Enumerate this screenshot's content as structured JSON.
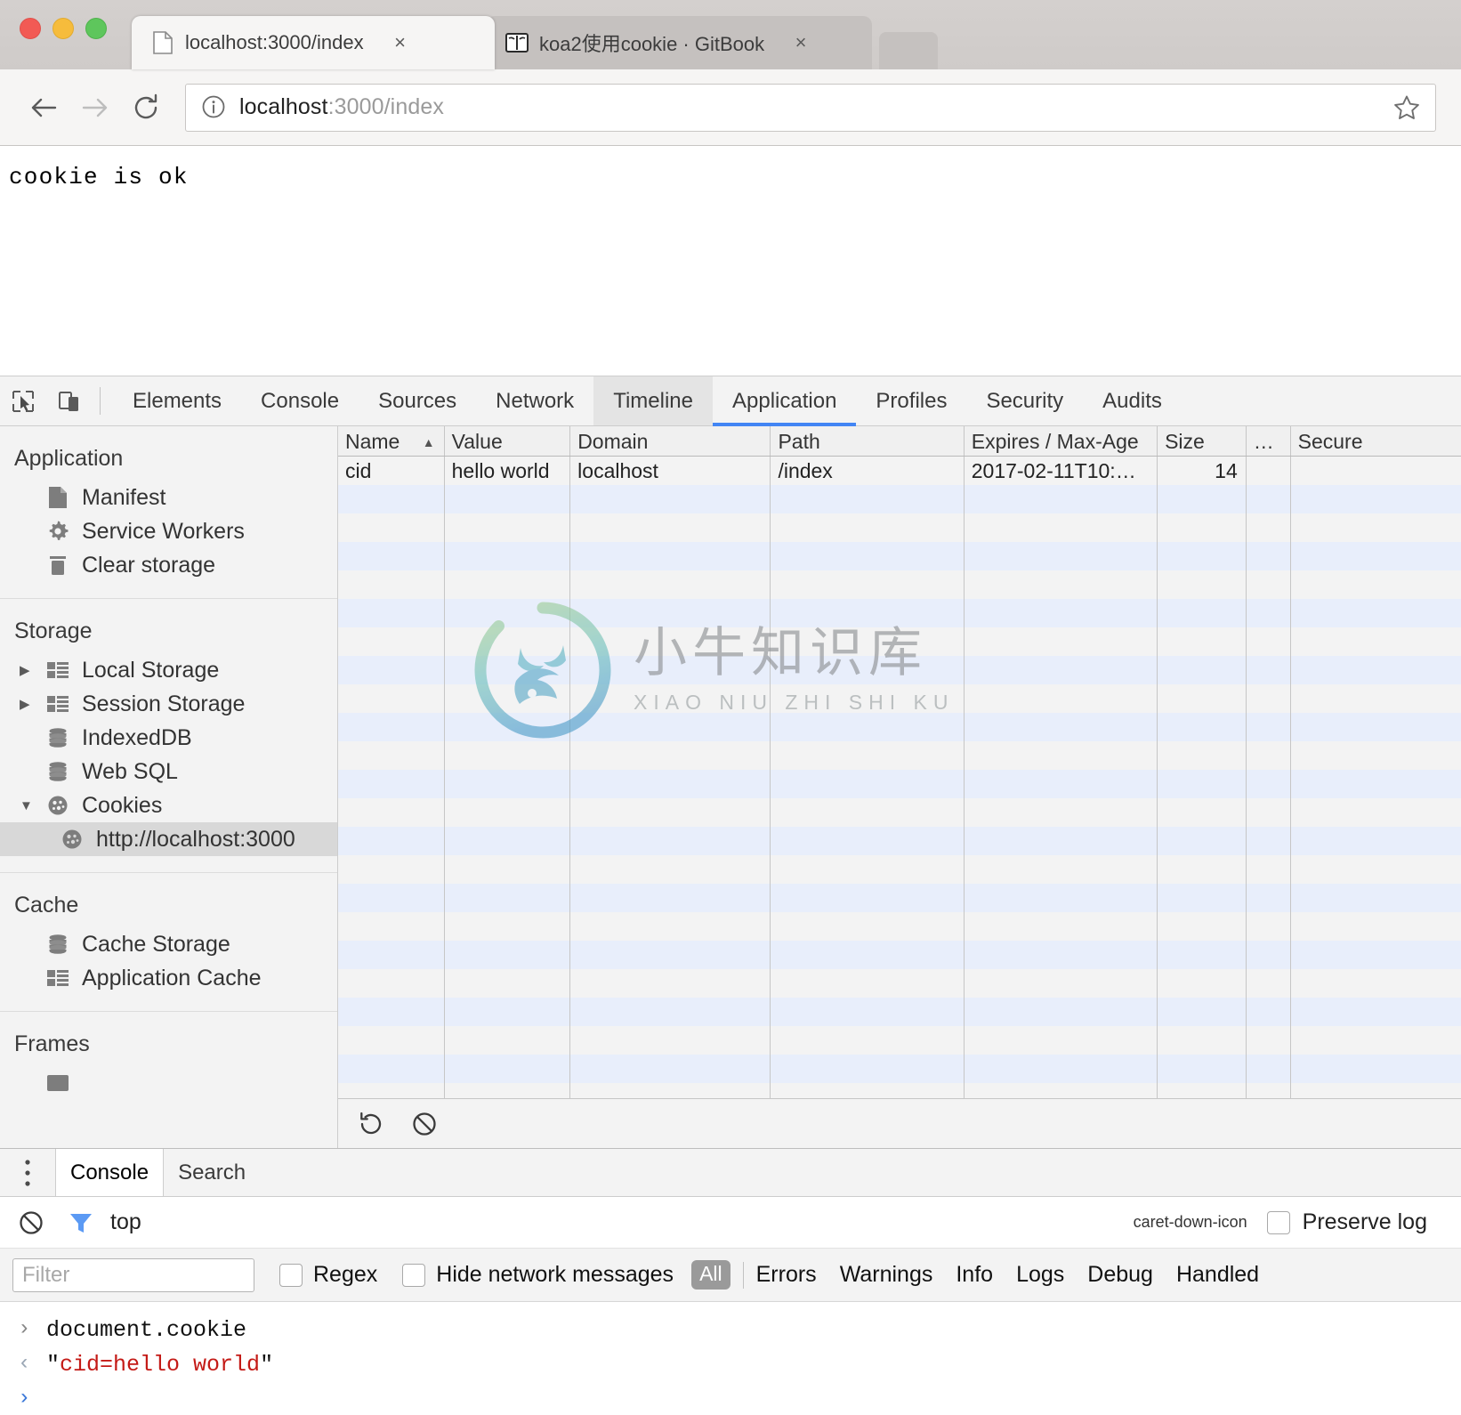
{
  "browser": {
    "tabs": [
      {
        "title": "localhost:3000/index",
        "icon": "page-icon",
        "active": true,
        "close_label": "×"
      },
      {
        "title": "koa2使用cookie · GitBook",
        "icon": "gitbook-icon",
        "active": false,
        "close_label": "×"
      }
    ],
    "omnibox": {
      "back_icon": "back-arrow-icon",
      "forward_icon": "forward-arrow-icon",
      "reload_icon": "reload-icon",
      "info_icon": "info-circle-icon",
      "url_host": "localhost",
      "url_rest": ":3000/index",
      "bookmark_icon": "star-icon"
    }
  },
  "page": {
    "body_text": "cookie is ok"
  },
  "devtools": {
    "toolbar": {
      "inspect_icon": "inspect-cursor-icon",
      "device_icon": "device-toolbar-icon"
    },
    "tabs": [
      {
        "label": "Elements",
        "state": "normal"
      },
      {
        "label": "Console",
        "state": "normal"
      },
      {
        "label": "Sources",
        "state": "normal"
      },
      {
        "label": "Network",
        "state": "normal"
      },
      {
        "label": "Timeline",
        "state": "hover"
      },
      {
        "label": "Application",
        "state": "active"
      },
      {
        "label": "Profiles",
        "state": "normal"
      },
      {
        "label": "Security",
        "state": "normal"
      },
      {
        "label": "Audits",
        "state": "normal"
      }
    ],
    "sidebar": [
      {
        "title": "Application",
        "items": [
          {
            "label": "Manifest",
            "icon": "manifest-file-icon",
            "arrow": "",
            "indent": false,
            "selected": false
          },
          {
            "label": "Service Workers",
            "icon": "gear-icon",
            "arrow": "",
            "indent": false,
            "selected": false
          },
          {
            "label": "Clear storage",
            "icon": "trash-icon",
            "arrow": "",
            "indent": false,
            "selected": false
          }
        ]
      },
      {
        "title": "Storage",
        "items": [
          {
            "label": "Local Storage",
            "icon": "table-grid-icon",
            "arrow": "▶",
            "indent": false,
            "selected": false
          },
          {
            "label": "Session Storage",
            "icon": "table-grid-icon",
            "arrow": "▶",
            "indent": false,
            "selected": false
          },
          {
            "label": "IndexedDB",
            "icon": "database-icon",
            "arrow": "",
            "indent": false,
            "selected": false
          },
          {
            "label": "Web SQL",
            "icon": "database-icon",
            "arrow": "",
            "indent": false,
            "selected": false
          },
          {
            "label": "Cookies",
            "icon": "cookie-icon",
            "arrow": "▼",
            "indent": false,
            "selected": false
          },
          {
            "label": "http://localhost:3000",
            "icon": "cookie-icon",
            "arrow": "",
            "indent": true,
            "selected": true
          }
        ]
      },
      {
        "title": "Cache",
        "items": [
          {
            "label": "Cache Storage",
            "icon": "database-icon",
            "arrow": "",
            "indent": false,
            "selected": false
          },
          {
            "label": "Application Cache",
            "icon": "table-grid-icon",
            "arrow": "",
            "indent": false,
            "selected": false
          }
        ]
      },
      {
        "title": "Frames",
        "items": []
      }
    ],
    "cookies_table": {
      "columns": [
        "Name",
        "Value",
        "Domain",
        "Path",
        "Expires / Max-Age",
        "Size",
        "…",
        "Secure"
      ],
      "sort_column": "Name",
      "sort_indicator": "▲",
      "rows": [
        {
          "Name": "cid",
          "Value": "hello world",
          "Domain": "localhost",
          "Path": "/index",
          "Expires / Max-Age": "2017-02-11T10:…",
          "Size": "14",
          "…": "",
          "Secure": ""
        }
      ]
    },
    "table_footer": {
      "refresh_icon": "refresh-icon",
      "clear_icon": "clear-all-cookies-icon"
    },
    "watermark": {
      "chinese": "小牛知识库",
      "pinyin": "XIAO NIU ZHI SHI KU"
    },
    "drawer": {
      "menu_icon": "more-vertical-icon",
      "tabs": [
        {
          "label": "Console",
          "active": true
        },
        {
          "label": "Search",
          "active": false
        }
      ],
      "toolbar": {
        "clear_icon": "clear-console-icon",
        "filter_icon": "filter-funnel-icon",
        "context": "top",
        "dropdown_icon": "caret-down-icon",
        "preserve_log_label": "Preserve log",
        "preserve_log_checked": false
      },
      "filter_row": {
        "filter_placeholder": "Filter",
        "filter_value": "",
        "regex_label": "Regex",
        "regex_checked": false,
        "hide_network_label": "Hide network messages",
        "hide_network_checked": false,
        "levels": [
          "All",
          "Errors",
          "Warnings",
          "Info",
          "Logs",
          "Debug",
          "Handled"
        ],
        "active_level": "All"
      },
      "console_lines": [
        {
          "marker": "›",
          "type": "input",
          "text": "document.cookie"
        },
        {
          "marker": "‹",
          "type": "output",
          "quote": "\"",
          "value": "cid=hello world"
        },
        {
          "marker": "›",
          "type": "prompt",
          "text": ""
        }
      ]
    }
  },
  "colors": {
    "accent_blue": "#4285f4",
    "selected_row": "#d8d8d8",
    "stripe": "#e8eefb",
    "console_string": "#c41a16",
    "prompt_blue": "#3b78d8"
  }
}
